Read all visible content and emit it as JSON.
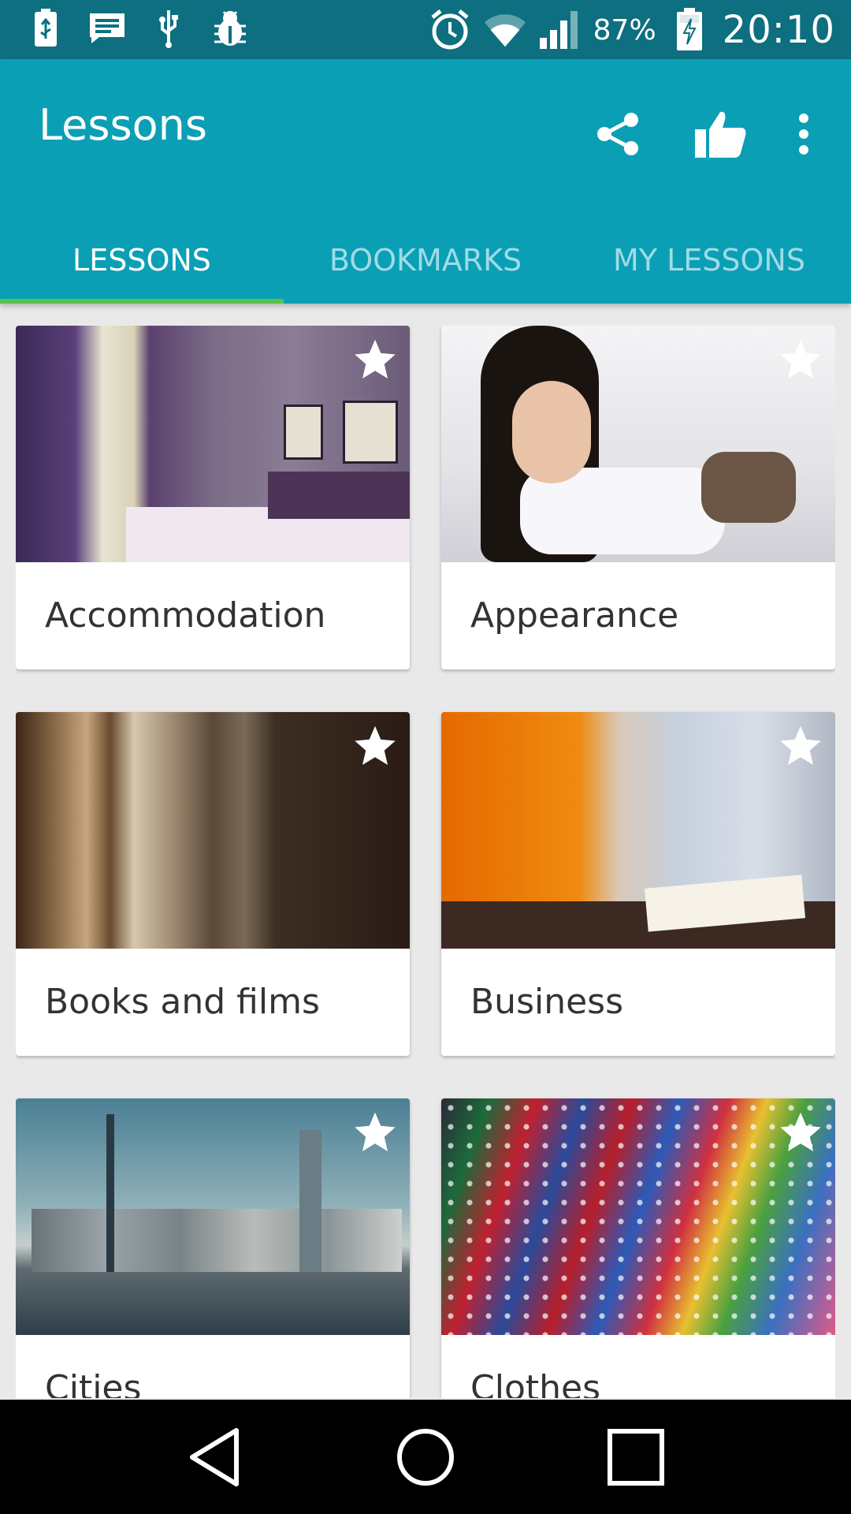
{
  "status_bar": {
    "battery_percent": "87%",
    "time": "20:10",
    "icons_left": [
      "usb-battery-icon",
      "message-icon",
      "usb-icon",
      "debug-bug-icon"
    ],
    "icons_right": [
      "alarm-icon",
      "wifi-icon",
      "signal-icon",
      "battery-charging-icon"
    ]
  },
  "app_bar": {
    "title": "Lessons",
    "actions": [
      "share-icon",
      "thumbs-up-icon",
      "more-vert-icon"
    ],
    "background": "#0a9fb5"
  },
  "tabs": [
    {
      "label": "LESSONS",
      "active": true
    },
    {
      "label": "BOOKMARKS",
      "active": false
    },
    {
      "label": "MY LESSONS",
      "active": false
    }
  ],
  "tab_indicator_color": "#58c24a",
  "lessons": [
    {
      "title": "Accommodation",
      "bookmarked": false
    },
    {
      "title": "Appearance",
      "bookmarked": false
    },
    {
      "title": "Books and films",
      "bookmarked": false
    },
    {
      "title": "Business",
      "bookmarked": false
    },
    {
      "title": "Cities",
      "bookmarked": false
    },
    {
      "title": "Clothes",
      "bookmarked": false
    }
  ],
  "nav_bar": [
    "back-icon",
    "home-icon",
    "recents-icon"
  ]
}
